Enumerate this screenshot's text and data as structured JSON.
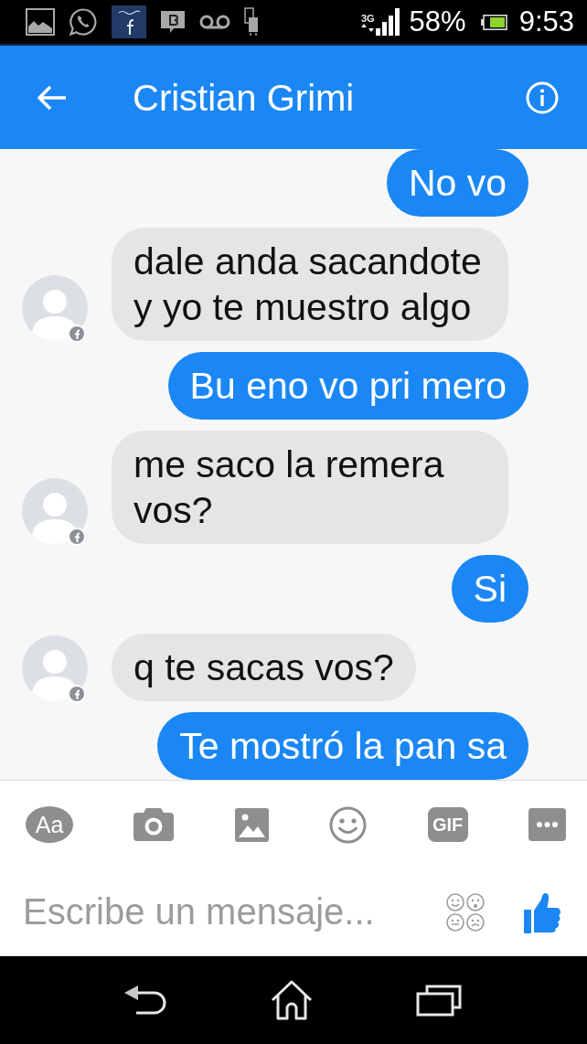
{
  "status_bar": {
    "network": "3G",
    "battery": "58%",
    "time": "9:53"
  },
  "header": {
    "title": "Cristian Grimi"
  },
  "messages": [
    {
      "kind": "outgoing",
      "text": "No vo"
    },
    {
      "kind": "incoming",
      "text": "dale anda sacandote y yo te muestro algo"
    },
    {
      "kind": "outgoing",
      "text": "Bu eno vo pri mero"
    },
    {
      "kind": "incoming",
      "text": "me saco la remera vos?"
    },
    {
      "kind": "outgoing",
      "text": "Si"
    },
    {
      "kind": "incoming",
      "text": "q te sacas vos?"
    },
    {
      "kind": "outgoing",
      "text": "Te mostró la pan sa"
    }
  ],
  "composer": {
    "tools": [
      {
        "kind": "format",
        "label": "Aa"
      },
      {
        "kind": "camera"
      },
      {
        "kind": "gallery"
      },
      {
        "kind": "emoji"
      },
      {
        "kind": "gif",
        "label": "GIF"
      },
      {
        "kind": "more"
      }
    ],
    "placeholder": "Escribe un mensaje..."
  }
}
